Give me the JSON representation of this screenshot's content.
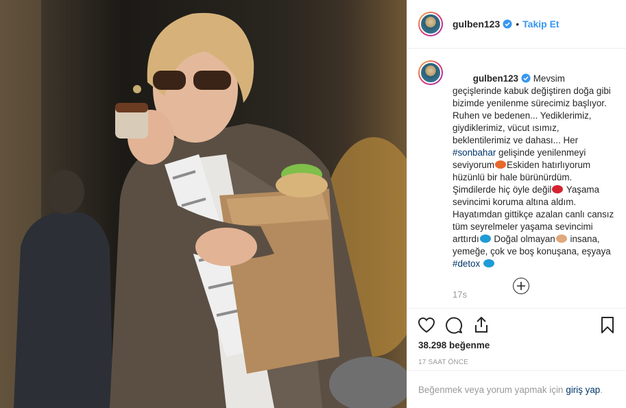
{
  "post": {
    "username": "gulben123",
    "separator": "•",
    "follow_label": "Takip Et",
    "caption_parts": [
      {
        "text": "Mevsim geçişlerinde kabuk değiştiren doğa gibi bizimde yenilenme sürecimiz başlıyor. Ruhen ve bedenen... Yediklerimiz, giydiklerimiz, vücut ısımız, beklentilerimiz ve dahası... Her "
      },
      {
        "hashtag": "#sonbahar"
      },
      {
        "text": " gelişinde yenilenmeyi seviyorum"
      },
      {
        "emoji": "leaf-emoji"
      },
      {
        "text": "Eskiden hatırlıyorum hüzünlü bir hale bürünürdüm. Şimdilerde hiç öyle değil"
      },
      {
        "emoji": "lips-emoji"
      },
      {
        "text": " Yaşama sevincimi koruma altına aldım. Hayatımdan gittikçe azalan canlı cansız tüm seyrelmeler yaşama sevincimi arttırdı"
      },
      {
        "emoji": "sunglasses-emoji"
      },
      {
        "text": " Doğal olmayan"
      },
      {
        "emoji": "pointing-hand-emoji"
      },
      {
        "text": " insana, yemeğe, çok ve boş konuşana, eşyaya "
      },
      {
        "hashtag": "#detox"
      },
      {
        "text": " "
      },
      {
        "emoji": "sunglasses-emoji"
      }
    ],
    "time_ago": "17s",
    "likes": "38.298 beğenme",
    "timestamp": "17 SAAT ÖNCE",
    "login_prompt": "Beğenmek veya yorum yapmak için",
    "login_link": "giriş yap",
    "login_end": ".",
    "icons": {
      "verified": "verified-badge-icon",
      "like": "heart-icon",
      "comment": "comment-icon",
      "share": "share-icon",
      "save": "bookmark-icon",
      "load_more": "plus-circle-icon"
    },
    "colors": {
      "link": "#3897f0",
      "hashtag": "#003569",
      "muted": "#999999",
      "text": "#262626"
    }
  }
}
